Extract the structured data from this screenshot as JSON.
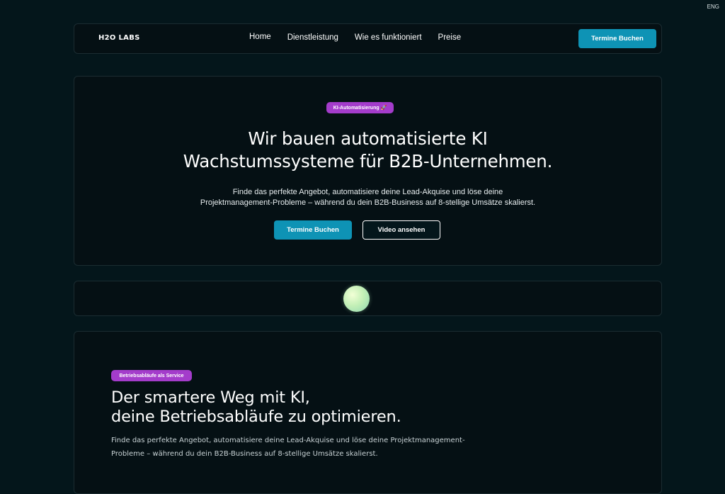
{
  "lang": "ENG",
  "nav": {
    "logo": "H2O LABS",
    "links": [
      "Home",
      "Dienstleistung",
      "Wie es funktioniert",
      "Preise"
    ],
    "cta": "Termine Buchen"
  },
  "hero": {
    "badge": "KI-Automatisierung 🚀",
    "title_line1": "Wir bauen automatisierte KI",
    "title_line2": "Wachstumssysteme für B2B-Unternehmen.",
    "sub_line1": "Finde das perfekte Angebot, automatisiere deine Lead-Akquise und löse deine",
    "sub_line2": "Projektmanagement-Probleme – während du dein B2B-Business auf 8-stellige Umsätze skalierst.",
    "primary_btn": "Termine Buchen",
    "secondary_btn": "Video ansehen"
  },
  "services": {
    "badge": "Betriebsabläufe als Service",
    "title_line1": "Der smartere Weg mit KI,",
    "title_line2": "deine Betriebsabläufe zu optimieren.",
    "sub_line1": "Finde das perfekte Angebot, automatisiere deine Lead-Akquise und löse deine Projektmanagement-",
    "sub_line2": "Probleme – während du dein B2B-Business auf 8-stellige Umsätze skalierst."
  },
  "colors": {
    "background": "#04161b",
    "accent": "#0e93b5",
    "badge": "#a43ccb"
  }
}
